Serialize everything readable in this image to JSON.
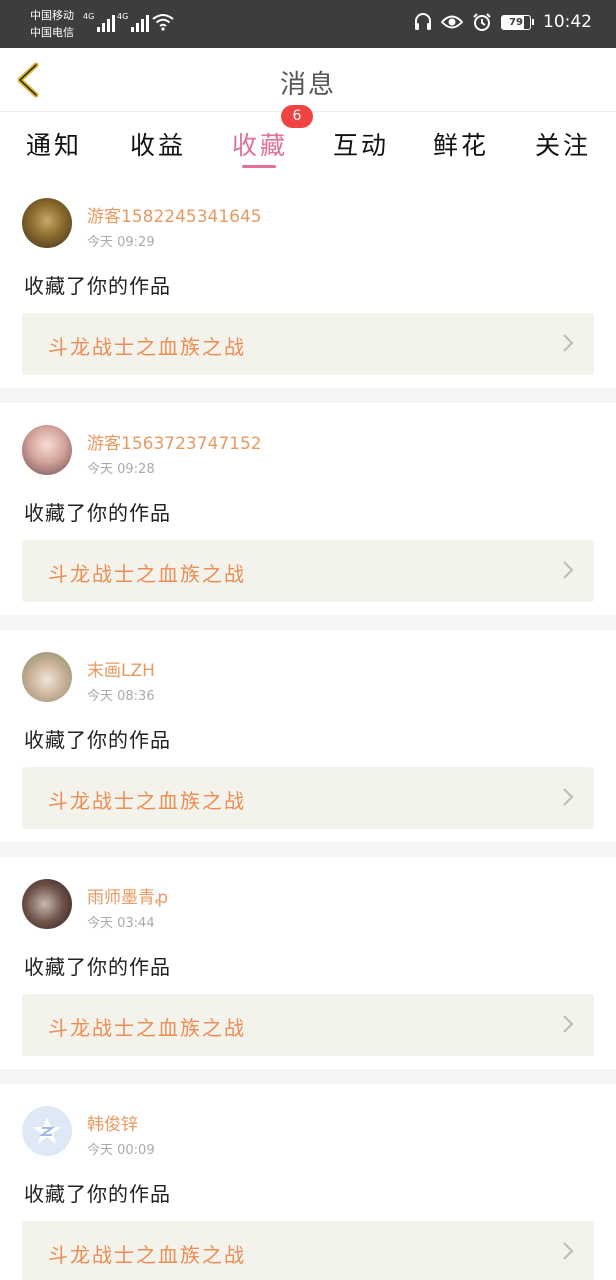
{
  "status_bar": {
    "carrier_1": "中国移动",
    "carrier_2": "中国电信",
    "network_1": "4G",
    "network_2": "4G",
    "battery": "79",
    "time": "10:42",
    "icons": [
      "headset-icon",
      "eye-icon",
      "alarm-icon",
      "wifi-icon",
      "battery-icon"
    ]
  },
  "header": {
    "title": "消息",
    "back_icon": "chevron-left-icon"
  },
  "tabs": [
    {
      "label": "通知"
    },
    {
      "label": "收益"
    },
    {
      "label": "收藏",
      "active": true,
      "badge": "6"
    },
    {
      "label": "互动"
    },
    {
      "label": "鲜花"
    },
    {
      "label": "关注"
    }
  ],
  "colors": {
    "accent_pink": "#e2709b",
    "username_orange": "#e79a62",
    "work_title_orange": "#ec8d56",
    "badge_red": "#f04343"
  },
  "items": [
    {
      "username": "游客1582245341645",
      "time": "今天 09:29",
      "action": "收藏了你的作品",
      "work_title": "斗龙战士之血族之战"
    },
    {
      "username": "游客1563723747152",
      "time": "今天 09:28",
      "action": "收藏了你的作品",
      "work_title": "斗龙战士之血族之战"
    },
    {
      "username": "末画LZH",
      "time": "今天 08:36",
      "action": "收藏了你的作品",
      "work_title": "斗龙战士之血族之战"
    },
    {
      "username": "雨师墨青ꝓ",
      "time": "今天 03:44",
      "action": "收藏了你的作品",
      "work_title": "斗龙战士之血族之战"
    },
    {
      "username": "韩俊锌",
      "time": "今天 00:09",
      "action": "收藏了你的作品",
      "work_title": "斗龙战士之血族之战"
    }
  ]
}
